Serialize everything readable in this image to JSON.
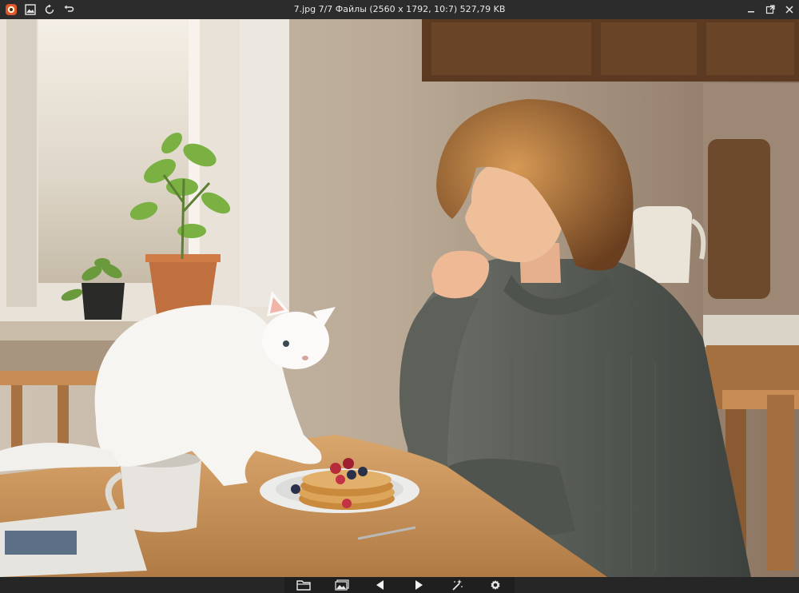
{
  "window": {
    "title": "7.jpg 7/7 Файлы (2560 x 1792, 10:7) 527,79 KB",
    "toolbar_icons": [
      "app-logo-icon",
      "gallery-icon",
      "rotate-icon",
      "undo-icon"
    ],
    "window_controls": [
      "minimize-icon",
      "maximize-icon",
      "close-icon"
    ]
  },
  "image": {
    "file_name": "7.jpg",
    "index": 7,
    "total": 7,
    "folder": "Файлы",
    "width": 2560,
    "height": 1792,
    "aspect_ratio": "10:7",
    "file_size": "527,79 KB"
  },
  "bottom_toolbar": {
    "icons": [
      "folder-icon",
      "image-gallery-icon",
      "previous-icon",
      "next-icon",
      "magic-wand-icon",
      "settings-icon"
    ]
  },
  "colors": {
    "titlebar_bg": "#2c2c2c",
    "bottombar_bg": "#262626",
    "accent_logo": "#e0562a"
  }
}
